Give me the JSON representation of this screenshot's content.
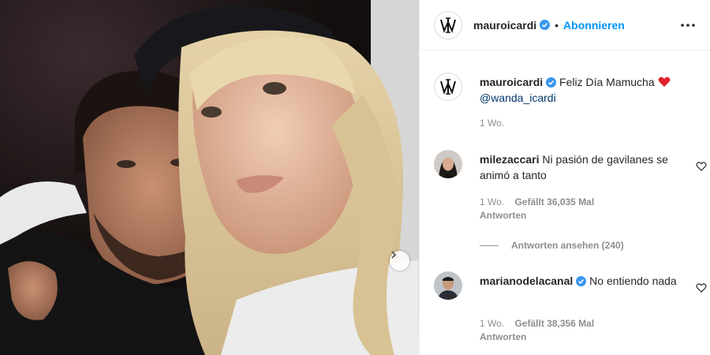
{
  "post": {
    "author": "mauroicardi",
    "follow_label": "Abonnieren",
    "dot": "•",
    "caption_text": "Feliz Día Mamucha",
    "caption_mention": "@wanda_icardi",
    "caption_time": "1 Wo."
  },
  "comments": [
    {
      "username": "milezaccari",
      "text": "Ni pasión de gavilanes se animó a tanto",
      "time": "1 Wo.",
      "likes": "Gefällt 36,035 Mal",
      "reply_label": "Antworten",
      "view_replies": "Antworten ansehen (240)"
    },
    {
      "username": "marianodelacanal",
      "text": "No entiendo nada",
      "time": "1 Wo.",
      "likes": "Gefällt 38,356 Mal",
      "reply_label": "Antworten"
    }
  ],
  "colors": {
    "accent": "#0095f6",
    "verified": "#3897f0",
    "heart": "#ed4956",
    "muted": "#8e8e8e"
  },
  "icons": {
    "more": "more-options-icon",
    "next": "chevron-right-icon",
    "like": "heart-outline-icon",
    "verified": "verified-badge-icon"
  }
}
